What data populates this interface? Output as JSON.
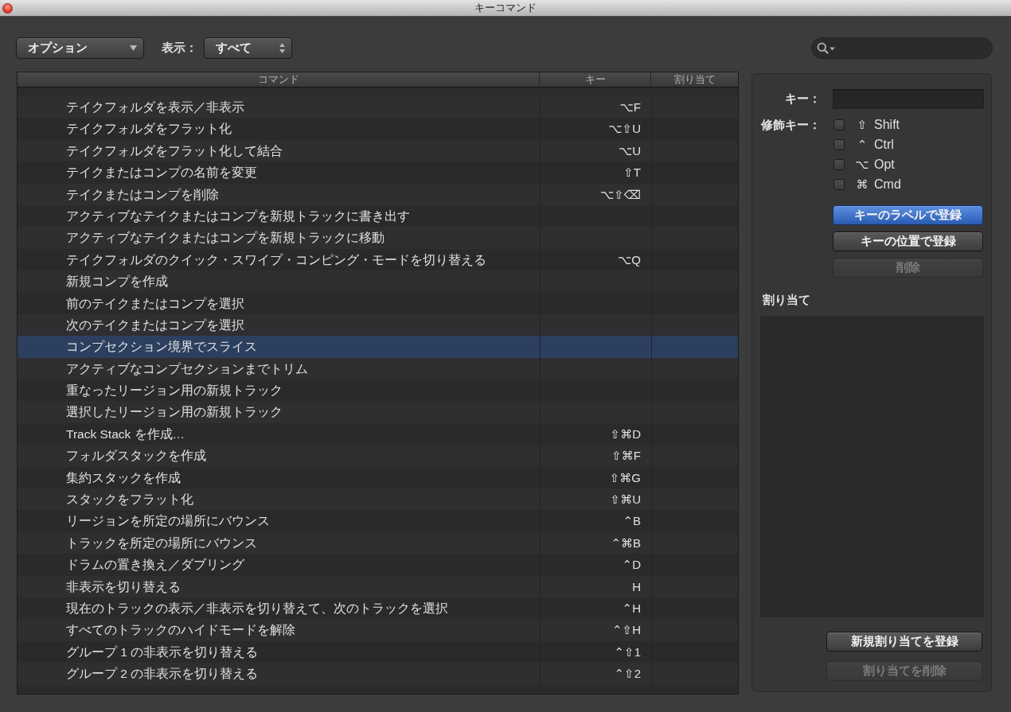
{
  "window": {
    "title": "キーコマンド"
  },
  "toolbar": {
    "options_menu": "オプション",
    "view_label": "表示：",
    "view_menu": "すべて"
  },
  "table": {
    "columns": [
      "コマンド",
      "キー",
      "割り当て"
    ],
    "rows": [
      {
        "command": "テイクフォルダを表示／非表示",
        "key": "⌥F",
        "selected": false
      },
      {
        "command": "テイクフォルダをフラット化",
        "key": "⌥⇧U",
        "selected": false
      },
      {
        "command": "テイクフォルダをフラット化して結合",
        "key": "⌥U",
        "selected": false
      },
      {
        "command": "テイクまたはコンプの名前を変更",
        "key": "⇧T",
        "selected": false
      },
      {
        "command": "テイクまたはコンプを削除",
        "key": "⌥⇧⌫",
        "selected": false
      },
      {
        "command": "アクティブなテイクまたはコンプを新規トラックに書き出す",
        "selected": false
      },
      {
        "command": "アクティブなテイクまたはコンプを新規トラックに移動",
        "selected": false
      },
      {
        "command": "テイクフォルダのクイック・スワイプ・コンピング・モードを切り替える",
        "key": "⌥Q",
        "selected": false
      },
      {
        "command": "新規コンプを作成",
        "selected": false
      },
      {
        "command": "前のテイクまたはコンプを選択",
        "selected": false
      },
      {
        "command": "次のテイクまたはコンプを選択",
        "selected": false
      },
      {
        "command": "コンプセクション境界でスライス",
        "selected": true
      },
      {
        "command": "アクティブなコンプセクションまでトリム",
        "selected": false
      },
      {
        "command": "重なったリージョン用の新規トラック",
        "selected": false
      },
      {
        "command": "選択したリージョン用の新規トラック",
        "selected": false
      },
      {
        "command": "Track Stack を作成…",
        "key": "⇧⌘D",
        "selected": false
      },
      {
        "command": "フォルダスタックを作成",
        "key": "⇧⌘F",
        "selected": false
      },
      {
        "command": "集約スタックを作成",
        "key": "⇧⌘G",
        "selected": false
      },
      {
        "command": "スタックをフラット化",
        "key": "⇧⌘U",
        "selected": false
      },
      {
        "command": "リージョンを所定の場所にバウンス",
        "key": "⌃B",
        "selected": false
      },
      {
        "command": "トラックを所定の場所にバウンス",
        "key": "⌃⌘B",
        "selected": false
      },
      {
        "command": "ドラムの置き換え／ダブリング",
        "key": "⌃D",
        "selected": false
      },
      {
        "command": "非表示を切り替える",
        "key": "H",
        "selected": false
      },
      {
        "command": "現在のトラックの表示／非表示を切り替えて、次のトラックを選択",
        "key": "⌃H",
        "selected": false
      },
      {
        "command": "すべてのトラックのハイドモードを解除",
        "key": "⌃⇧H",
        "selected": false
      },
      {
        "command": "グループ 1 の非表示を切り替える",
        "key": "⌃⇧1",
        "selected": false
      },
      {
        "command": "グループ 2 の非表示を切り替える",
        "key": "⌃⇧2",
        "selected": false
      }
    ]
  },
  "key_panel": {
    "key_label": "キー：",
    "modifiers_label": "修飾キー：",
    "modifiers": [
      {
        "symbol": "⇧",
        "label": "Shift",
        "checked": false
      },
      {
        "symbol": "⌃",
        "label": "Ctrl",
        "checked": false
      },
      {
        "symbol": "⌥",
        "label": "Opt",
        "checked": false
      },
      {
        "symbol": "⌘",
        "label": "Cmd",
        "checked": false
      }
    ],
    "buttons": [
      {
        "label": "キーのラベルで登録",
        "default": true,
        "disabled": false
      },
      {
        "label": "キーの位置で登録",
        "default": false,
        "disabled": false
      },
      {
        "label": "削除",
        "default": false,
        "disabled": true
      }
    ],
    "assignments_label": "割り当て",
    "assignment_buttons": [
      {
        "label": "新規割り当てを登録",
        "disabled": false
      },
      {
        "label": "割り当てを削除",
        "disabled": true
      }
    ]
  }
}
